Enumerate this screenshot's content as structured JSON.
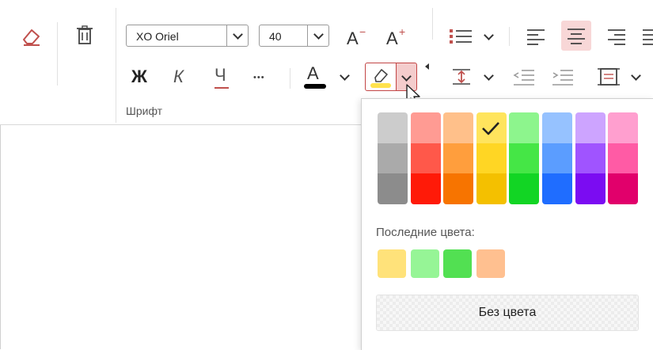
{
  "ribbon": {
    "font_name": "XO Oriel",
    "font_size": "40",
    "font_group_label": "Шрифт",
    "grow_font_label": "A",
    "grow_font_sup": "+",
    "shrink_font_label": "A",
    "shrink_font_sup": "−",
    "bold_label": "Ж",
    "italic_label": "К",
    "underline_label": "Ч",
    "more_label": "•••",
    "font_color_letter": "A",
    "accent_highlight": "#f8d7d7"
  },
  "color_panel": {
    "palette_columns": [
      {
        "name": "gray",
        "colors": [
          "#cccccc",
          "#aaaaaa",
          "#8c8c8c"
        ]
      },
      {
        "name": "red",
        "colors": [
          "#ff9b93",
          "#ff584a",
          "#ff1a08"
        ]
      },
      {
        "name": "orange",
        "colors": [
          "#ffc08a",
          "#ff9e3d",
          "#f77400"
        ]
      },
      {
        "name": "yellow",
        "colors": [
          "#ffe45d",
          "#ffd624",
          "#f4c000"
        ]
      },
      {
        "name": "green",
        "colors": [
          "#8df58d",
          "#45e646",
          "#12d524"
        ]
      },
      {
        "name": "blue",
        "colors": [
          "#96c2ff",
          "#5b9dff",
          "#1f6dff"
        ]
      },
      {
        "name": "purple",
        "colors": [
          "#cda4ff",
          "#a054ff",
          "#7b0cf2"
        ]
      },
      {
        "name": "pink",
        "colors": [
          "#ff9fcf",
          "#ff5ba5",
          "#e1006b"
        ]
      }
    ],
    "selected": "yellow-1",
    "recent_label": "Последние цвета:",
    "recent_colors": [
      "#ffe27a",
      "#96f596",
      "#52e052",
      "#ffc090"
    ],
    "no_color_label": "Без цвета"
  }
}
